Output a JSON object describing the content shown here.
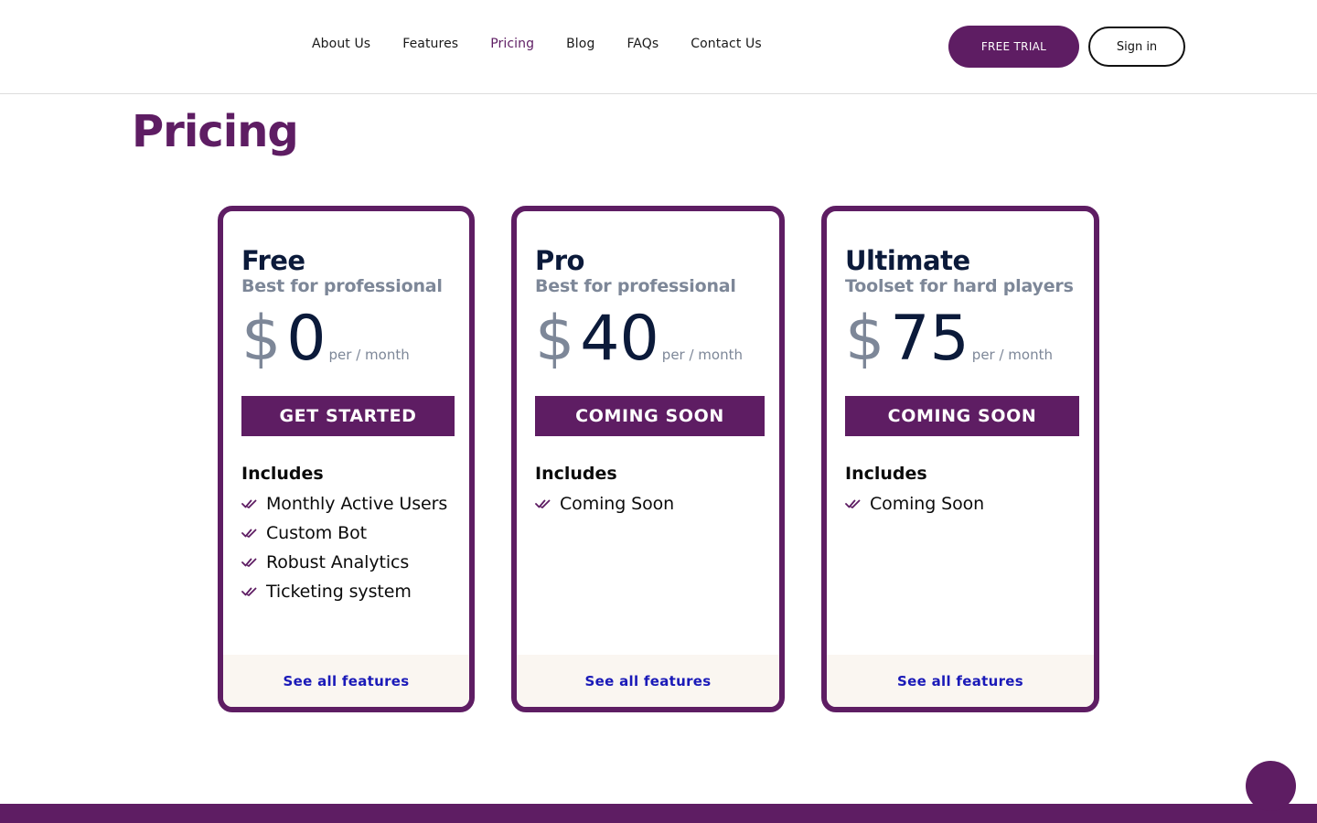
{
  "nav": {
    "links": [
      "About Us",
      "Features",
      "Pricing",
      "Blog",
      "FAQs",
      "Contact Us"
    ],
    "active": "Pricing",
    "trial_label": "FREE TRIAL",
    "signin_label": "Sign in"
  },
  "page": {
    "title": "Pricing"
  },
  "colors": {
    "brand": "#5e1d63",
    "heading": "#0b1a3a",
    "muted": "#7d8798",
    "link": "#1a1ab8",
    "footer_bg": "#faf6f1"
  },
  "plans": [
    {
      "name": "Free",
      "subtitle": "Best for professional",
      "currency": "$",
      "price": "0",
      "period": "per / month",
      "cta": "GET STARTED",
      "includes_label": "Includes",
      "features": [
        "Monthly Active Users",
        "Custom Bot",
        "Robust Analytics",
        "Ticketing system"
      ],
      "footer_link": "See all features"
    },
    {
      "name": "Pro",
      "subtitle": "Best for professional",
      "currency": "$",
      "price": "40",
      "period": "per / month",
      "cta": "COMING SOON",
      "includes_label": "Includes",
      "features": [
        "Coming Soon"
      ],
      "footer_link": "See all features"
    },
    {
      "name": "Ultimate",
      "subtitle": "Toolset for hard players",
      "currency": "$",
      "price": "75",
      "period": "per / month",
      "cta": "COMING SOON",
      "includes_label": "Includes",
      "features": [
        "Coming Soon"
      ],
      "footer_link": "See all features"
    }
  ]
}
